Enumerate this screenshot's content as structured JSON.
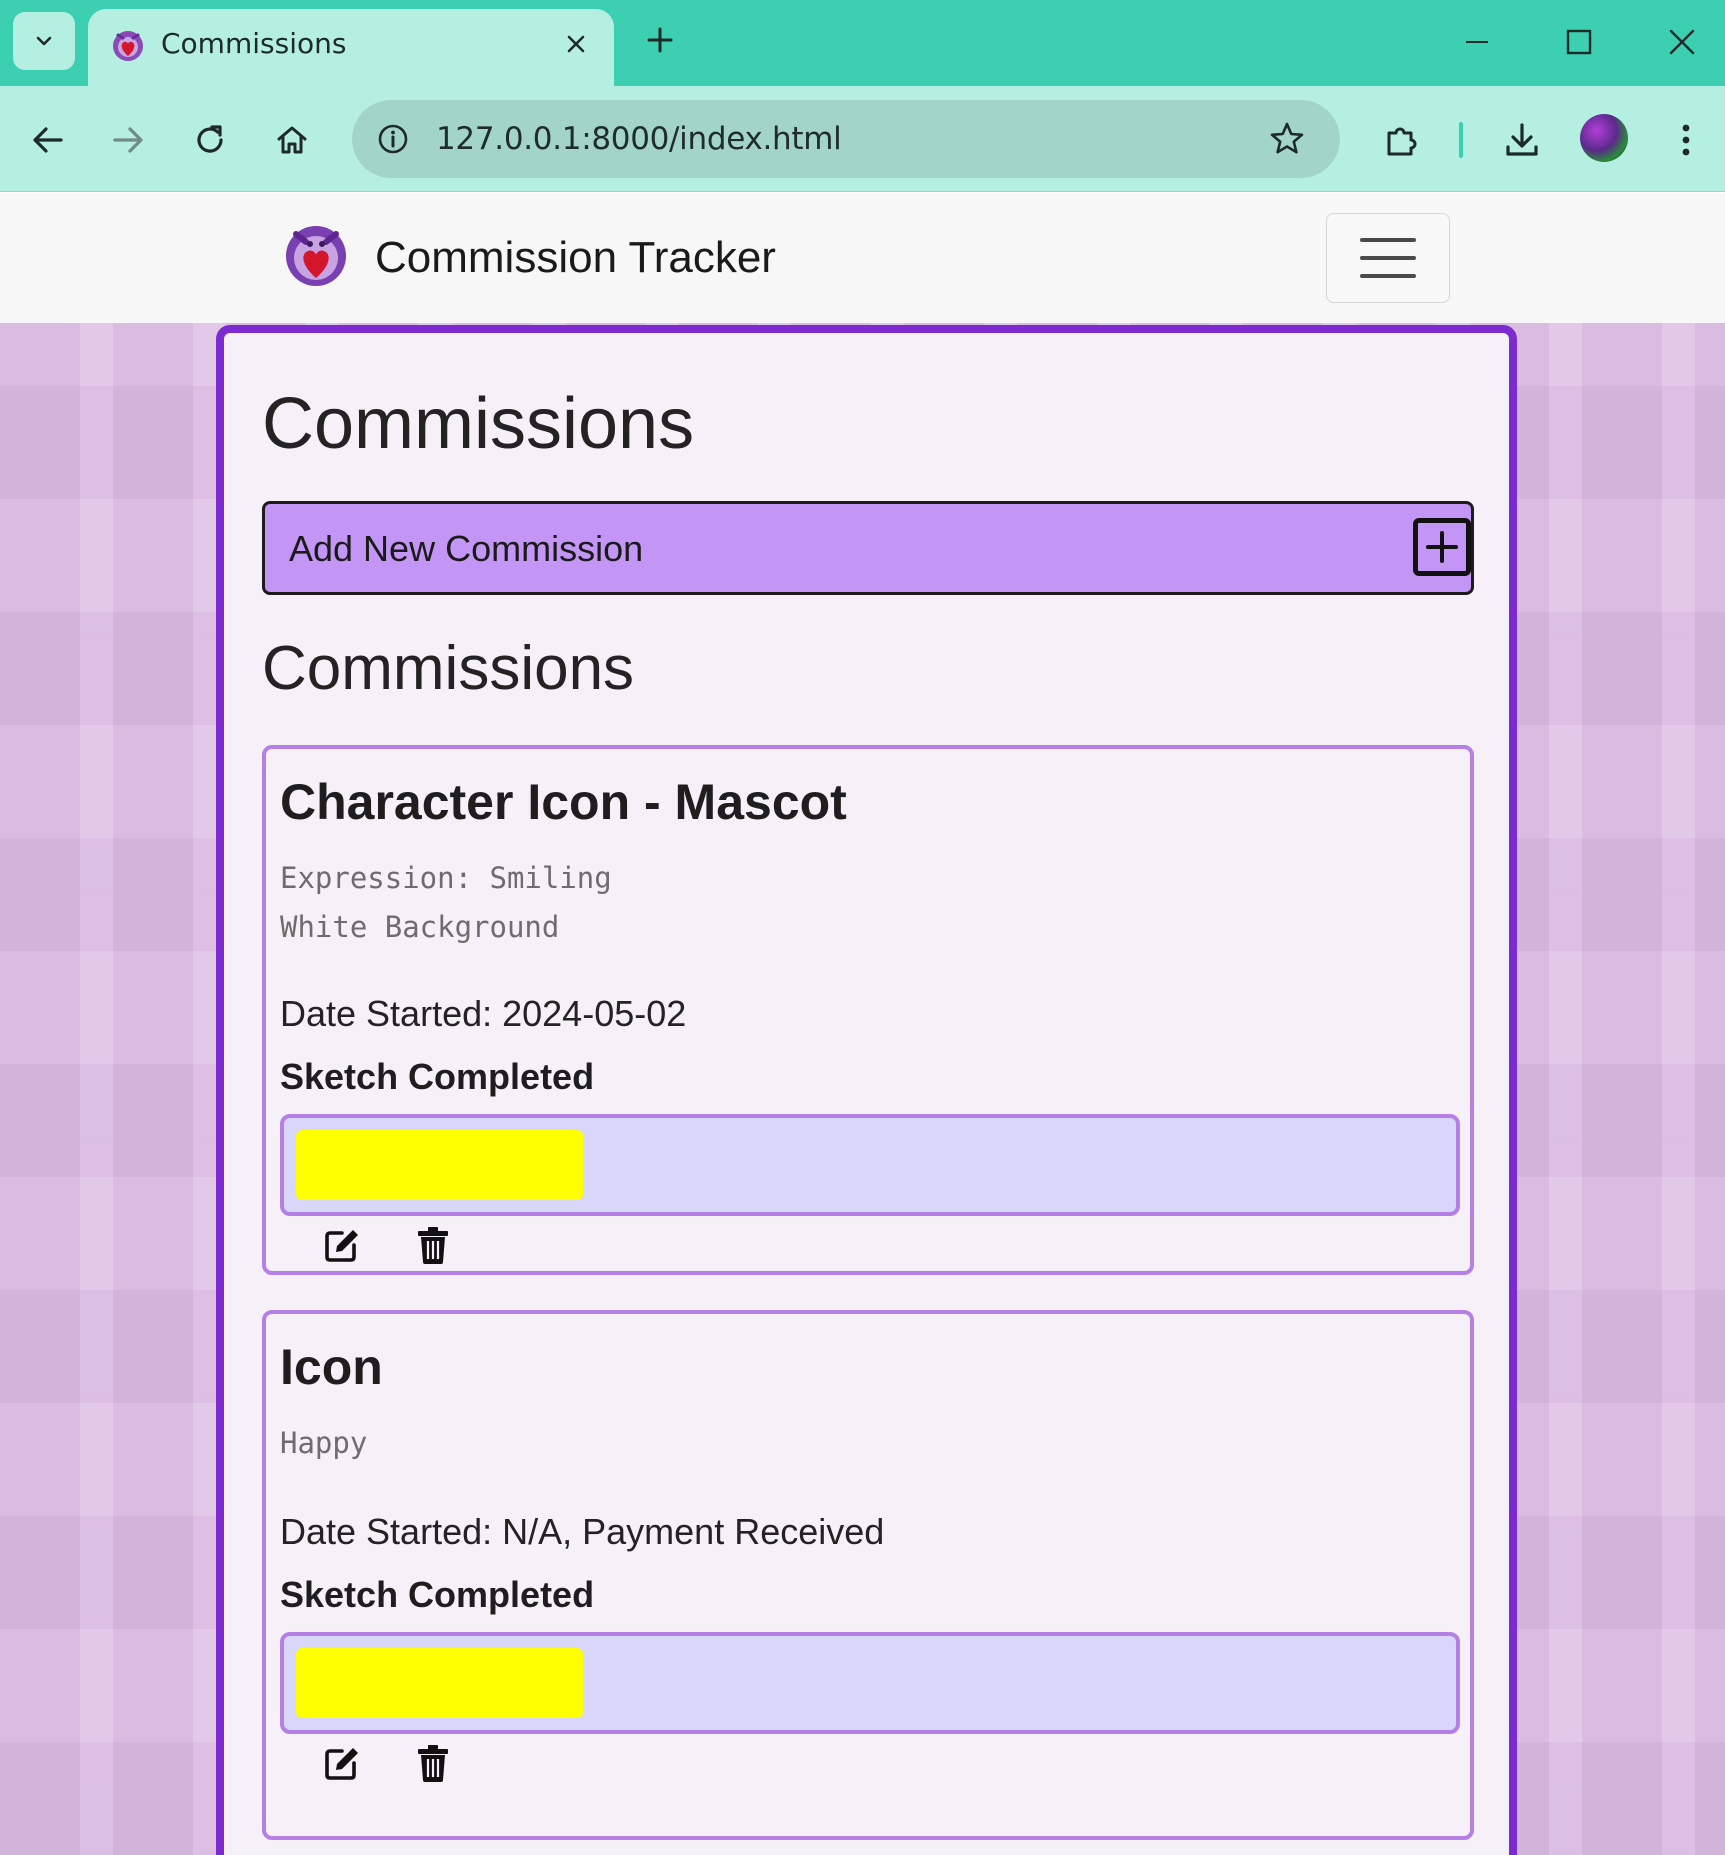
{
  "browser": {
    "tab_title": "Commissions",
    "url": "127.0.0.1:8000/index.html",
    "accent": "#3ccfb2"
  },
  "navbar": {
    "brand": "Commission Tracker"
  },
  "main": {
    "heading": "Commissions",
    "add_button_label": "Add New Commission",
    "list_heading": "Commissions",
    "commissions": [
      {
        "title": "Character Icon - Mascot",
        "notes": "Expression: Smiling\nWhite Background",
        "date": "Date Started: 2024-05-02",
        "status": "Sketch Completed",
        "progress": 0.25,
        "progress_color": "#ffff00"
      },
      {
        "title": "Icon",
        "notes": "Happy",
        "date": "Date Started: N/A, Payment Received",
        "status": "Sketch Completed",
        "progress": 0.25,
        "progress_color": "#ffff00"
      }
    ]
  },
  "icons": {
    "edit": "pencil-square-icon",
    "delete": "trash-icon",
    "add": "plus-square-icon"
  }
}
